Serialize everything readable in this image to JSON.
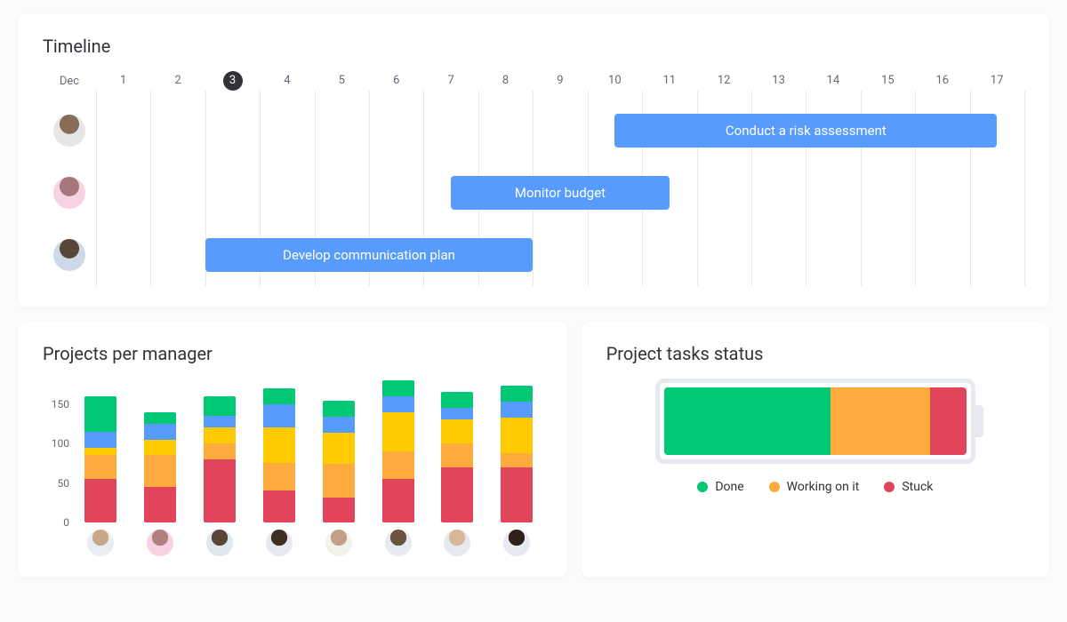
{
  "timeline": {
    "title": "Timeline",
    "month": "Dec",
    "current_day": 3,
    "days": [
      1,
      2,
      3,
      4,
      5,
      6,
      7,
      8,
      9,
      10,
      11,
      12,
      13,
      14,
      15,
      16,
      17
    ],
    "rows": [
      {
        "avatar_class": "av-1",
        "task": {
          "label": "Conduct a risk assessment",
          "start_day": 10.5,
          "end_day": 17.5
        }
      },
      {
        "avatar_class": "av-2",
        "task": {
          "label": "Monitor budget",
          "start_day": 7.5,
          "end_day": 11.5
        }
      },
      {
        "avatar_class": "av-3",
        "task": {
          "label": "Develop communication plan",
          "start_day": 3.0,
          "end_day": 9.0
        }
      }
    ]
  },
  "projects_per_manager": {
    "title": "Projects per manager"
  },
  "project_status": {
    "title": "Project tasks status",
    "legend": {
      "done": "Done",
      "working": "Working on it",
      "stuck": "Stuck"
    }
  },
  "chart_data": [
    {
      "type": "bar",
      "title": "Projects per manager",
      "x_avatars": [
        "av-4",
        "av-5",
        "av-6",
        "av-7",
        "av-8",
        "av-9",
        "av-10",
        "av-11"
      ],
      "ylabel": "",
      "ylim": [
        0,
        180
      ],
      "yticks": [
        0,
        50,
        100,
        150
      ],
      "stack_order": [
        "red",
        "orange",
        "yellow",
        "blue",
        "green"
      ],
      "series": [
        {
          "name": "red",
          "color": "#e2445c",
          "values": [
            55,
            45,
            80,
            40,
            32,
            55,
            70,
            70
          ]
        },
        {
          "name": "orange",
          "color": "#fdab3d",
          "values": [
            30,
            40,
            20,
            35,
            42,
            35,
            30,
            18
          ]
        },
        {
          "name": "yellow",
          "color": "#ffcb00",
          "values": [
            10,
            20,
            20,
            45,
            40,
            50,
            30,
            45
          ]
        },
        {
          "name": "blue",
          "color": "#579bfc",
          "values": [
            20,
            20,
            15,
            30,
            20,
            20,
            15,
            20
          ]
        },
        {
          "name": "green",
          "color": "#00c875",
          "values": [
            45,
            15,
            25,
            20,
            20,
            20,
            20,
            20
          ]
        }
      ]
    },
    {
      "type": "pie",
      "title": "Project tasks status",
      "categories": [
        "Done",
        "Working on it",
        "Stuck"
      ],
      "values": [
        55,
        33,
        12
      ],
      "colors": [
        "#00c875",
        "#fdab3d",
        "#e2445c"
      ]
    }
  ]
}
